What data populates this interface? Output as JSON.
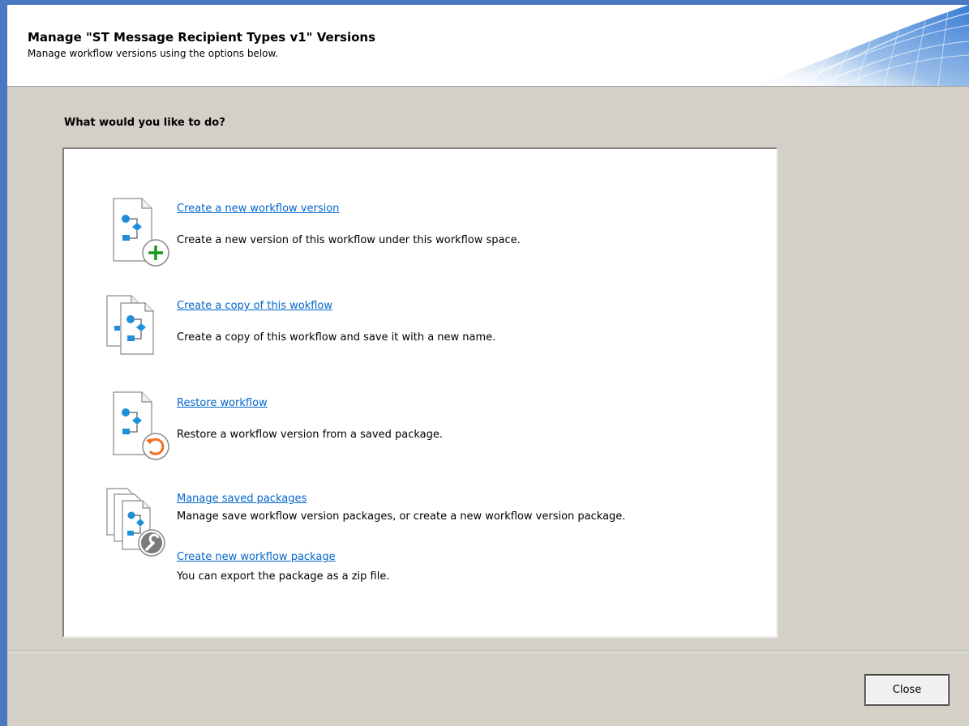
{
  "header": {
    "title": "Manage \"ST Message Recipient Types v1\" Versions",
    "subtitle": "Manage workflow versions using the options below."
  },
  "question": "What would you like to do?",
  "options": [
    {
      "icon": "new-workflow-version-icon",
      "link": "Create a new workflow version",
      "description": "Create a new version of this workflow under this workflow space."
    },
    {
      "icon": "copy-workflow-icon",
      "link": "Create a copy of this wokflow",
      "description": "Create a copy of this workflow and save it with a new name."
    },
    {
      "icon": "restore-workflow-icon",
      "link": "Restore workflow",
      "description": "Restore a workflow version from a saved package."
    },
    {
      "icon": "manage-packages-icon",
      "link": "Manage saved packages",
      "description": "Manage save workflow version packages, or create a new workflow version package.",
      "link2": "Create new workflow package",
      "description2": "You can export the package as a zip file."
    }
  ],
  "footer": {
    "close_label": "Close"
  },
  "colors": {
    "window_border": "#4a78c2",
    "dialog_bg": "#d4d0c8",
    "link": "#0066cc",
    "add_green": "#1a9a1a",
    "restore_orange": "#f07020",
    "flow_blue": "#1e8fd8"
  }
}
